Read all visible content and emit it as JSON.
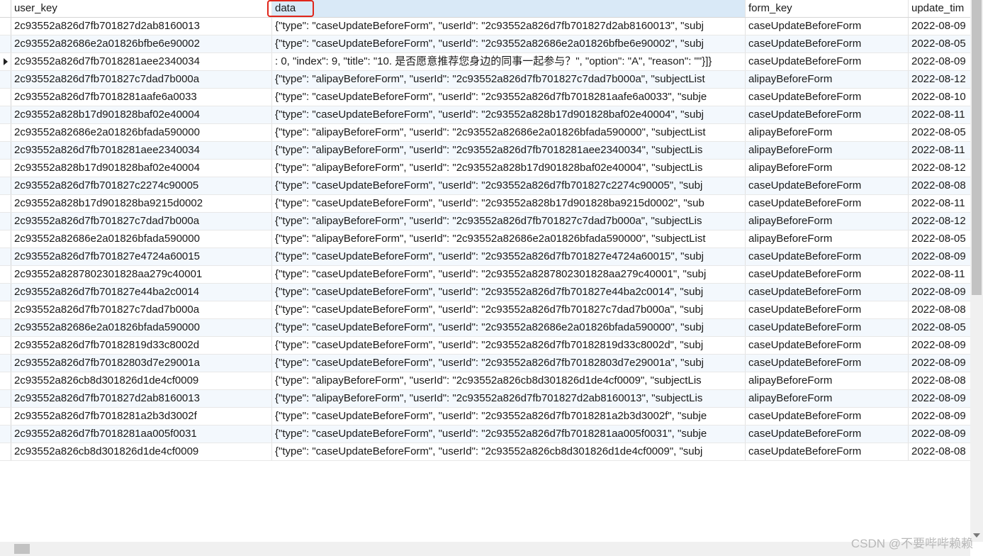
{
  "columns": {
    "user_key": "user_key",
    "data": "data",
    "form_key": "form_key",
    "update_time": "update_tim"
  },
  "rows": [
    {
      "user_key": "2c93552a826d7fb701827d2ab8160013",
      "data": "{\"type\": \"caseUpdateBeforeForm\", \"userId\": \"2c93552a826d7fb701827d2ab8160013\", \"subj",
      "form_key": "caseUpdateBeforeForm",
      "update_time": "2022-08-09"
    },
    {
      "user_key": "2c93552a82686e2a01826bfbe6e90002",
      "data": "{\"type\": \"caseUpdateBeforeForm\", \"userId\": \"2c93552a82686e2a01826bfbe6e90002\", \"subj",
      "form_key": "caseUpdateBeforeForm",
      "update_time": "2022-08-05"
    },
    {
      "user_key": "2c93552a826d7fb7018281aee2340034",
      "data": ": 0, \"index\": 9, \"title\": \"10. 是否愿意推荐您身边的同事一起参与？\", \"option\": \"A\", \"reason\": \"\"}]}",
      "form_key": "caseUpdateBeforeForm",
      "update_time": "2022-08-09",
      "editing": true
    },
    {
      "user_key": "2c93552a826d7fb701827c7dad7b000a",
      "data": "{\"type\": \"alipayBeforeForm\", \"userId\": \"2c93552a826d7fb701827c7dad7b000a\", \"subjectList",
      "form_key": "alipayBeforeForm",
      "update_time": "2022-08-12"
    },
    {
      "user_key": "2c93552a826d7fb7018281aafe6a0033",
      "data": "{\"type\": \"caseUpdateBeforeForm\", \"userId\": \"2c93552a826d7fb7018281aafe6a0033\", \"subje",
      "form_key": "caseUpdateBeforeForm",
      "update_time": "2022-08-10"
    },
    {
      "user_key": "2c93552a828b17d901828baf02e40004",
      "data": "{\"type\": \"caseUpdateBeforeForm\", \"userId\": \"2c93552a828b17d901828baf02e40004\", \"subj",
      "form_key": "caseUpdateBeforeForm",
      "update_time": "2022-08-11"
    },
    {
      "user_key": "2c93552a82686e2a01826bfada590000",
      "data": "{\"type\": \"alipayBeforeForm\", \"userId\": \"2c93552a82686e2a01826bfada590000\", \"subjectList",
      "form_key": "alipayBeforeForm",
      "update_time": "2022-08-05"
    },
    {
      "user_key": "2c93552a826d7fb7018281aee2340034",
      "data": "{\"type\": \"alipayBeforeForm\", \"userId\": \"2c93552a826d7fb7018281aee2340034\", \"subjectLis",
      "form_key": "alipayBeforeForm",
      "update_time": "2022-08-11"
    },
    {
      "user_key": "2c93552a828b17d901828baf02e40004",
      "data": "{\"type\": \"alipayBeforeForm\", \"userId\": \"2c93552a828b17d901828baf02e40004\", \"subjectLis",
      "form_key": "alipayBeforeForm",
      "update_time": "2022-08-12"
    },
    {
      "user_key": "2c93552a826d7fb701827c2274c90005",
      "data": "{\"type\": \"caseUpdateBeforeForm\", \"userId\": \"2c93552a826d7fb701827c2274c90005\", \"subj",
      "form_key": "caseUpdateBeforeForm",
      "update_time": "2022-08-08"
    },
    {
      "user_key": "2c93552a828b17d901828ba9215d0002",
      "data": "{\"type\": \"caseUpdateBeforeForm\", \"userId\": \"2c93552a828b17d901828ba9215d0002\", \"sub",
      "form_key": "caseUpdateBeforeForm",
      "update_time": "2022-08-11"
    },
    {
      "user_key": "2c93552a826d7fb701827c7dad7b000a",
      "data": "{\"type\": \"alipayBeforeForm\", \"userId\": \"2c93552a826d7fb701827c7dad7b000a\", \"subjectLis",
      "form_key": "alipayBeforeForm",
      "update_time": "2022-08-12"
    },
    {
      "user_key": "2c93552a82686e2a01826bfada590000",
      "data": "{\"type\": \"alipayBeforeForm\", \"userId\": \"2c93552a82686e2a01826bfada590000\", \"subjectList",
      "form_key": "alipayBeforeForm",
      "update_time": "2022-08-05"
    },
    {
      "user_key": "2c93552a826d7fb701827e4724a60015",
      "data": "{\"type\": \"caseUpdateBeforeForm\", \"userId\": \"2c93552a826d7fb701827e4724a60015\", \"subj",
      "form_key": "caseUpdateBeforeForm",
      "update_time": "2022-08-09"
    },
    {
      "user_key": "2c93552a8287802301828aa279c40001",
      "data": "{\"type\": \"caseUpdateBeforeForm\", \"userId\": \"2c93552a8287802301828aa279c40001\", \"subj",
      "form_key": "caseUpdateBeforeForm",
      "update_time": "2022-08-11"
    },
    {
      "user_key": "2c93552a826d7fb701827e44ba2c0014",
      "data": "{\"type\": \"caseUpdateBeforeForm\", \"userId\": \"2c93552a826d7fb701827e44ba2c0014\", \"subj",
      "form_key": "caseUpdateBeforeForm",
      "update_time": "2022-08-09"
    },
    {
      "user_key": "2c93552a826d7fb701827c7dad7b000a",
      "data": "{\"type\": \"caseUpdateBeforeForm\", \"userId\": \"2c93552a826d7fb701827c7dad7b000a\", \"subj",
      "form_key": "caseUpdateBeforeForm",
      "update_time": "2022-08-08"
    },
    {
      "user_key": "2c93552a82686e2a01826bfada590000",
      "data": "{\"type\": \"caseUpdateBeforeForm\", \"userId\": \"2c93552a82686e2a01826bfada590000\", \"subj",
      "form_key": "caseUpdateBeforeForm",
      "update_time": "2022-08-05"
    },
    {
      "user_key": "2c93552a826d7fb70182819d33c8002d",
      "data": "{\"type\": \"caseUpdateBeforeForm\", \"userId\": \"2c93552a826d7fb70182819d33c8002d\", \"subj",
      "form_key": "caseUpdateBeforeForm",
      "update_time": "2022-08-09"
    },
    {
      "user_key": "2c93552a826d7fb70182803d7e29001a",
      "data": "{\"type\": \"caseUpdateBeforeForm\", \"userId\": \"2c93552a826d7fb70182803d7e29001a\", \"subj",
      "form_key": "caseUpdateBeforeForm",
      "update_time": "2022-08-09"
    },
    {
      "user_key": "2c93552a826cb8d301826d1de4cf0009",
      "data": "{\"type\": \"alipayBeforeForm\", \"userId\": \"2c93552a826cb8d301826d1de4cf0009\", \"subjectLis",
      "form_key": "alipayBeforeForm",
      "update_time": "2022-08-08"
    },
    {
      "user_key": "2c93552a826d7fb701827d2ab8160013",
      "data": "{\"type\": \"alipayBeforeForm\", \"userId\": \"2c93552a826d7fb701827d2ab8160013\", \"subjectLis",
      "form_key": "alipayBeforeForm",
      "update_time": "2022-08-09"
    },
    {
      "user_key": "2c93552a826d7fb7018281a2b3d3002f",
      "data": "{\"type\": \"caseUpdateBeforeForm\", \"userId\": \"2c93552a826d7fb7018281a2b3d3002f\", \"subje",
      "form_key": "caseUpdateBeforeForm",
      "update_time": "2022-08-09"
    },
    {
      "user_key": "2c93552a826d7fb7018281aa005f0031",
      "data": "{\"type\": \"caseUpdateBeforeForm\", \"userId\": \"2c93552a826d7fb7018281aa005f0031\", \"subje",
      "form_key": "caseUpdateBeforeForm",
      "update_time": "2022-08-09"
    },
    {
      "user_key": "2c93552a826cb8d301826d1de4cf0009",
      "data": "{\"type\": \"caseUpdateBeforeForm\", \"userId\": \"2c93552a826cb8d301826d1de4cf0009\", \"subj",
      "form_key": "caseUpdateBeforeForm",
      "update_time": "2022-08-08"
    }
  ],
  "watermark": "CSDN @不要哔哔赖赖",
  "colors": {
    "highlight_border": "#e0251b",
    "selected_header": "#d9e9f7",
    "alt_row": "#f3f8fd"
  }
}
